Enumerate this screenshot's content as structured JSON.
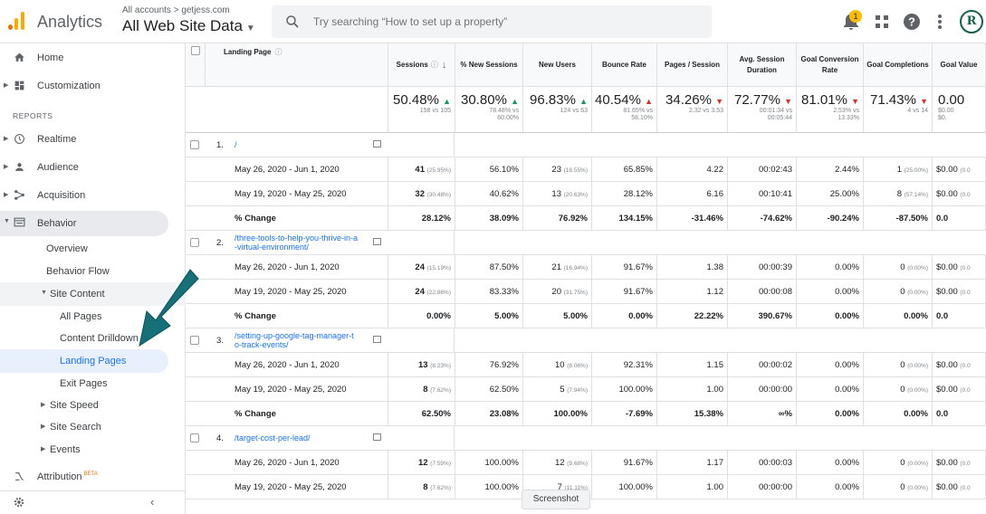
{
  "header": {
    "app_name": "Analytics",
    "account_breadcrumb": "All accounts > getjess.com",
    "property": "All Web Site Data",
    "search_placeholder": "Try searching “How to set up a property”",
    "notification_count": "1",
    "avatar_letter": "R",
    "colors": {
      "logo_orange": "#f9ab00",
      "logo_dark": "#e37400",
      "avatar": "#17604e"
    }
  },
  "sidebar": {
    "home": "Home",
    "customization": "Customization",
    "reports_label": "REPORTS",
    "realtime": "Realtime",
    "audience": "Audience",
    "acquisition": "Acquisition",
    "behavior": "Behavior",
    "overview": "Overview",
    "behavior_flow": "Behavior Flow",
    "site_content": "Site Content",
    "all_pages": "All Pages",
    "content_drilldown": "Content Drilldown",
    "landing_pages": "Landing Pages",
    "exit_pages": "Exit Pages",
    "site_speed": "Site Speed",
    "site_search": "Site Search",
    "events": "Events",
    "attribution": "Attribution",
    "beta": "BETA"
  },
  "table": {
    "headers": {
      "landing_page": "Landing Page",
      "sessions": "Sessions",
      "new_sessions": "% New Sessions",
      "new_users": "New Users",
      "bounce_rate": "Bounce Rate",
      "pages_session": "Pages / Session",
      "avg_session": "Avg. Session Duration",
      "goal_conv": "Goal Conversion Rate",
      "goal_comp": "Goal Completions",
      "goal_value": "Goal Value"
    },
    "summary": {
      "sessions": {
        "big": "50.48%",
        "small": "158 vs 105"
      },
      "new_sessions": {
        "big": "30.80%",
        "small1": "78.48% vs",
        "small2": "60.00%"
      },
      "new_users": {
        "big": "96.83%",
        "small": "124 vs 63"
      },
      "bounce_rate": {
        "big": "40.54%",
        "small1": "81.65% vs",
        "small2": "58.10%"
      },
      "pages_session": {
        "big": "34.26%",
        "small": "2.32 vs 3.53"
      },
      "avg_session": {
        "big": "72.77%",
        "small1": "00:01:34 vs",
        "small2": "00:05:44"
      },
      "goal_conv": {
        "big": "81.01%",
        "small1": "2.53% vs",
        "small2": "13.33%"
      },
      "goal_comp": {
        "big": "71.43%",
        "small": "4 vs 14"
      },
      "goal_value": {
        "big": "0.00",
        "small1": "$0.00",
        "small2": "$0."
      }
    },
    "pages": [
      {
        "index": "1.",
        "path": "/",
        "rows": [
          {
            "label": "May 26, 2020 - Jun 1, 2020",
            "sessions": "41",
            "sessions_pct": "(25.95%)",
            "new_sessions": "56.10%",
            "new_users": "23",
            "new_users_pct": "(18.55%)",
            "bounce": "65.85%",
            "pps": "4.22",
            "dur": "00:02:43",
            "conv": "2.44%",
            "comp": "1",
            "comp_pct": "(25.00%)",
            "value": "$0.00",
            "value_pct": "(0.0"
          },
          {
            "label": "May 19, 2020 - May 25, 2020",
            "sessions": "32",
            "sessions_pct": "(30.48%)",
            "new_sessions": "40.62%",
            "new_users": "13",
            "new_users_pct": "(20.63%)",
            "bounce": "28.12%",
            "pps": "6.16",
            "dur": "00:10:41",
            "conv": "25.00%",
            "comp": "8",
            "comp_pct": "(57.14%)",
            "value": "$0.00",
            "value_pct": "(0.0"
          },
          {
            "label": "% Change",
            "sessions": "28.12%",
            "new_sessions": "38.09%",
            "new_users": "76.92%",
            "bounce": "134.15%",
            "pps": "-31.46%",
            "dur": "-74.62%",
            "conv": "-90.24%",
            "comp": "-87.50%",
            "value": "0.0"
          }
        ]
      },
      {
        "index": "2.",
        "path1": "/three-tools-to-help-you-thrive-in-a",
        "path2": "-virtual-environment/",
        "rows": [
          {
            "label": "May 26, 2020 - Jun 1, 2020",
            "sessions": "24",
            "sessions_pct": "(15.19%)",
            "new_sessions": "87.50%",
            "new_users": "21",
            "new_users_pct": "(16.94%)",
            "bounce": "91.67%",
            "pps": "1.38",
            "dur": "00:00:39",
            "conv": "0.00%",
            "comp": "0",
            "comp_pct": "(0.00%)",
            "value": "$0.00",
            "value_pct": "(0.0"
          },
          {
            "label": "May 19, 2020 - May 25, 2020",
            "sessions": "24",
            "sessions_pct": "(22.86%)",
            "new_sessions": "83.33%",
            "new_users": "20",
            "new_users_pct": "(31.75%)",
            "bounce": "91.67%",
            "pps": "1.12",
            "dur": "00:00:08",
            "conv": "0.00%",
            "comp": "0",
            "comp_pct": "(0.00%)",
            "value": "$0.00",
            "value_pct": "(0.0"
          },
          {
            "label": "% Change",
            "sessions": "0.00%",
            "new_sessions": "5.00%",
            "new_users": "5.00%",
            "bounce": "0.00%",
            "pps": "22.22%",
            "dur": "390.67%",
            "conv": "0.00%",
            "comp": "0.00%",
            "value": "0.0"
          }
        ]
      },
      {
        "index": "3.",
        "path1": "/setting-up-google-tag-manager-t",
        "path2": "o-track-events/",
        "rows": [
          {
            "label": "May 26, 2020 - Jun 1, 2020",
            "sessions": "13",
            "sessions_pct": "(8.23%)",
            "new_sessions": "76.92%",
            "new_users": "10",
            "new_users_pct": "(8.06%)",
            "bounce": "92.31%",
            "pps": "1.15",
            "dur": "00:00:02",
            "conv": "0.00%",
            "comp": "0",
            "comp_pct": "(0.00%)",
            "value": "$0.00",
            "value_pct": "(0.0"
          },
          {
            "label": "May 19, 2020 - May 25, 2020",
            "sessions": "8",
            "sessions_pct": "(7.62%)",
            "new_sessions": "62.50%",
            "new_users": "5",
            "new_users_pct": "(7.94%)",
            "bounce": "100.00%",
            "pps": "1.00",
            "dur": "00:00:00",
            "conv": "0.00%",
            "comp": "0",
            "comp_pct": "(0.00%)",
            "value": "$0.00",
            "value_pct": "(0.0"
          },
          {
            "label": "% Change",
            "sessions": "62.50%",
            "new_sessions": "23.08%",
            "new_users": "100.00%",
            "bounce": "-7.69%",
            "pps": "15.38%",
            "dur": "∞%",
            "conv": "0.00%",
            "comp": "0.00%",
            "value": "0.0"
          }
        ]
      },
      {
        "index": "4.",
        "path": "/target-cost-per-lead/",
        "rows": [
          {
            "label": "May 26, 2020 - Jun 1, 2020",
            "sessions": "12",
            "sessions_pct": "(7.59%)",
            "new_sessions": "100.00%",
            "new_users": "12",
            "new_users_pct": "(9.68%)",
            "bounce": "91.67%",
            "pps": "1.17",
            "dur": "00:00:03",
            "conv": "0.00%",
            "comp": "0",
            "comp_pct": "(0.00%)",
            "value": "$0.00",
            "value_pct": "(0.0"
          },
          {
            "label": "May 19, 2020 - May 25, 2020",
            "sessions": "8",
            "sessions_pct": "(7.62%)",
            "new_sessions": "100.00%",
            "new_users": "7",
            "new_users_pct": "(11.11%)",
            "bounce": "100.00%",
            "pps": "1.00",
            "dur": "00:00:00",
            "conv": "0.00%",
            "comp": "0",
            "comp_pct": "(0.00%)",
            "value": "$0.00",
            "value_pct": "(0.0"
          }
        ]
      }
    ],
    "tooltip": "Screenshot"
  }
}
